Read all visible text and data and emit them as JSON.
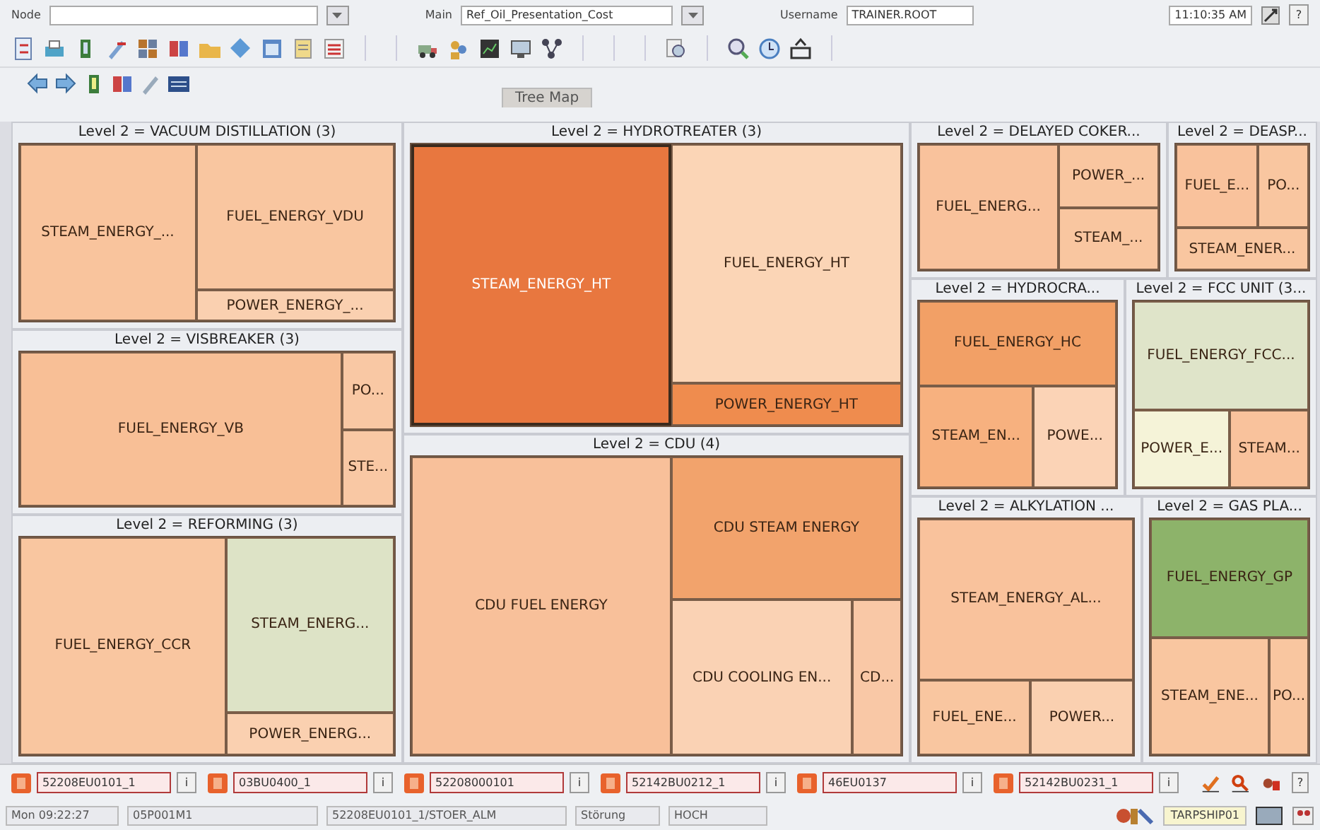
{
  "top_bar": {
    "node_label": "Node",
    "main_label": "Main",
    "main_value": "Ref_Oil_Presentation_Cost",
    "username_label": "Username",
    "username_value": "TRAINER.ROOT",
    "time": "11:10:35 AM",
    "help": "?"
  },
  "tabs": [
    {
      "label": "Tree Map",
      "selected": true
    }
  ],
  "treemap": {
    "columns": [
      {
        "groups": [
          {
            "title": "Level 2 = VACUUM DISTILLATION (3)",
            "cells": [
              {
                "label": "STEAM_ENERGY_...",
                "color": "#f9c49d",
                "selected": false
              },
              {
                "label": "FUEL_ENERGY_VDU",
                "color": "#f9c6a0",
                "selected": false
              },
              {
                "label": "POWER_ENERGY_...",
                "color": "#fad0b0",
                "selected": false
              }
            ]
          },
          {
            "title": "Level 2 = VISBREAKER (3)",
            "cells": [
              {
                "label": "FUEL_ENERGY_VB",
                "color": "#f8bf96",
                "selected": false
              },
              {
                "label": "PO...",
                "color": "#f9c8a4",
                "selected": false
              },
              {
                "label": "STE...",
                "color": "#f9c8a4",
                "selected": false
              }
            ]
          },
          {
            "title": "Level 2 = REFORMING (3)",
            "cells": [
              {
                "label": "FUEL_ENERGY_CCR",
                "color": "#f9c6a0",
                "selected": false
              },
              {
                "label": "STEAM_ENERG...",
                "color": "#dde3c6",
                "selected": false
              },
              {
                "label": "POWER_ENERG...",
                "color": "#fad0b0",
                "selected": false
              }
            ]
          }
        ]
      },
      {
        "groups": [
          {
            "title": "Level 2 = HYDROTREATER (3)",
            "cells": [
              {
                "label": "STEAM_ENERGY_HT",
                "color": "#e8773f",
                "selected": true
              },
              {
                "label": "FUEL_ENERGY_HT",
                "color": "#fbd5b6",
                "selected": false
              },
              {
                "label": "POWER_ENERGY_HT",
                "color": "#ef8c4e",
                "selected": false
              }
            ]
          },
          {
            "title": "Level 2 = CDU (4)",
            "cells": [
              {
                "label": "CDU FUEL ENERGY",
                "color": "#f8c09a",
                "selected": false
              },
              {
                "label": "CDU STEAM ENERGY",
                "color": "#f2a36c",
                "selected": false
              },
              {
                "label": "CDU COOLING EN...",
                "color": "#fad2b4",
                "selected": false
              },
              {
                "label": "CD...",
                "color": "#f9c8a6",
                "selected": false
              }
            ]
          }
        ]
      },
      {
        "groups": [
          {
            "title": "Level 2 = DELAYED COKER...",
            "cells": [
              {
                "label": "FUEL_ENERG...",
                "color": "#f9c29c",
                "selected": false
              },
              {
                "label": "POWER_...",
                "color": "#f9c6a0",
                "selected": false
              },
              {
                "label": "STEAM_...",
                "color": "#f9c6a0",
                "selected": false
              }
            ]
          },
          {
            "title": "Level 2 = DEASP...",
            "cells": [
              {
                "label": "FUEL_E...",
                "color": "#f9c29c",
                "selected": false
              },
              {
                "label": "PO...",
                "color": "#f9c6a0",
                "selected": false
              },
              {
                "label": "STEAM_ENER...",
                "color": "#f9c6a0",
                "selected": false
              }
            ]
          },
          {
            "title": "Level 2 = HYDROCRA...",
            "cells": [
              {
                "label": "FUEL_ENERGY_HC",
                "color": "#f2a066",
                "selected": false
              },
              {
                "label": "STEAM_EN...",
                "color": "#f7b17f",
                "selected": false
              },
              {
                "label": "POWE...",
                "color": "#fbd3b6",
                "selected": false
              }
            ]
          },
          {
            "title": "Level 2 = FCC UNIT (3...",
            "cells": [
              {
                "label": "FUEL_ENERGY_FCC...",
                "color": "#dfe4c9",
                "selected": false
              },
              {
                "label": "POWER_E...",
                "color": "#f5f3d8",
                "selected": false
              },
              {
                "label": "STEAM...",
                "color": "#f9c29c",
                "selected": false
              }
            ]
          },
          {
            "title": "Level 2 = ALKYLATION ...",
            "cells": [
              {
                "label": "STEAM_ENERGY_AL...",
                "color": "#f9c29c",
                "selected": false
              },
              {
                "label": "FUEL_ENE...",
                "color": "#f9c6a0",
                "selected": false
              },
              {
                "label": "POWER...",
                "color": "#fad0b0",
                "selected": false
              }
            ]
          },
          {
            "title": "Level 2 = GAS PLA...",
            "cells": [
              {
                "label": "FUEL_ENERGY_GP",
                "color": "#8db36a",
                "selected": false
              },
              {
                "label": "STEAM_ENE...",
                "color": "#f9c6a0",
                "selected": false
              },
              {
                "label": "PO...",
                "color": "#f9c6a0",
                "selected": false
              }
            ]
          }
        ]
      }
    ]
  },
  "alarms": [
    {
      "tag": "52208EU0101_1",
      "info": "i"
    },
    {
      "tag": "03BU0400_1",
      "info": "i"
    },
    {
      "tag": "52208000101",
      "info": "i"
    },
    {
      "tag": "52142BU0212_1",
      "info": "i"
    },
    {
      "tag": "46EU0137",
      "info": "i"
    },
    {
      "tag": "52142BU0231_1",
      "info": "i"
    }
  ],
  "alarm_help": "?",
  "status_bar": {
    "fields": [
      "Mon 09:22:27",
      "05P001M1",
      "52208EU0101_1/STOER_ALM",
      "Störung",
      "HOCH"
    ],
    "station": "TARPSHIP01"
  }
}
